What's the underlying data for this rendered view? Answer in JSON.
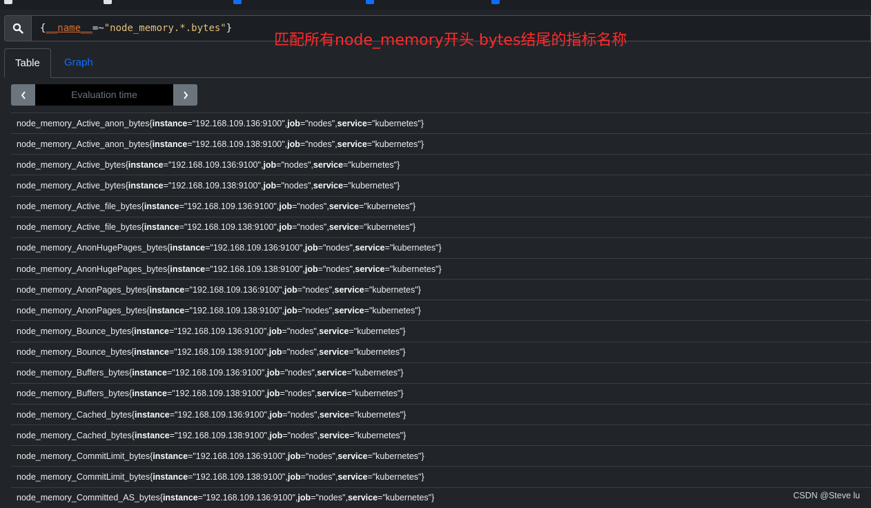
{
  "query": {
    "open_brace": "{",
    "label": "__name__",
    "operator": "=~",
    "value": "\"node_memory.*.bytes\"",
    "close_brace": "}"
  },
  "annotation": "匹配所有node_memory开头   bytes结尾的指标名称",
  "tabs": {
    "table": "Table",
    "graph": "Graph"
  },
  "evaluation": {
    "placeholder": "Evaluation time"
  },
  "label_keys": {
    "instance": "instance",
    "job": "job",
    "service": "service"
  },
  "results": [
    {
      "metric": "node_memory_Active_anon_bytes",
      "instance": "\"192.168.109.136:9100\"",
      "job": "\"nodes\"",
      "service": "\"kubernetes\""
    },
    {
      "metric": "node_memory_Active_anon_bytes",
      "instance": "\"192.168.109.138:9100\"",
      "job": "\"nodes\"",
      "service": "\"kubernetes\""
    },
    {
      "metric": "node_memory_Active_bytes",
      "instance": "\"192.168.109.136:9100\"",
      "job": "\"nodes\"",
      "service": "\"kubernetes\""
    },
    {
      "metric": "node_memory_Active_bytes",
      "instance": "\"192.168.109.138:9100\"",
      "job": "\"nodes\"",
      "service": "\"kubernetes\""
    },
    {
      "metric": "node_memory_Active_file_bytes",
      "instance": "\"192.168.109.136:9100\"",
      "job": "\"nodes\"",
      "service": "\"kubernetes\""
    },
    {
      "metric": "node_memory_Active_file_bytes",
      "instance": "\"192.168.109.138:9100\"",
      "job": "\"nodes\"",
      "service": "\"kubernetes\""
    },
    {
      "metric": "node_memory_AnonHugePages_bytes",
      "instance": "\"192.168.109.136:9100\"",
      "job": "\"nodes\"",
      "service": "\"kubernetes\""
    },
    {
      "metric": "node_memory_AnonHugePages_bytes",
      "instance": "\"192.168.109.138:9100\"",
      "job": "\"nodes\"",
      "service": "\"kubernetes\""
    },
    {
      "metric": "node_memory_AnonPages_bytes",
      "instance": "\"192.168.109.136:9100\"",
      "job": "\"nodes\"",
      "service": "\"kubernetes\""
    },
    {
      "metric": "node_memory_AnonPages_bytes",
      "instance": "\"192.168.109.138:9100\"",
      "job": "\"nodes\"",
      "service": "\"kubernetes\""
    },
    {
      "metric": "node_memory_Bounce_bytes",
      "instance": "\"192.168.109.136:9100\"",
      "job": "\"nodes\"",
      "service": "\"kubernetes\""
    },
    {
      "metric": "node_memory_Bounce_bytes",
      "instance": "\"192.168.109.138:9100\"",
      "job": "\"nodes\"",
      "service": "\"kubernetes\""
    },
    {
      "metric": "node_memory_Buffers_bytes",
      "instance": "\"192.168.109.136:9100\"",
      "job": "\"nodes\"",
      "service": "\"kubernetes\""
    },
    {
      "metric": "node_memory_Buffers_bytes",
      "instance": "\"192.168.109.138:9100\"",
      "job": "\"nodes\"",
      "service": "\"kubernetes\""
    },
    {
      "metric": "node_memory_Cached_bytes",
      "instance": "\"192.168.109.136:9100\"",
      "job": "\"nodes\"",
      "service": "\"kubernetes\""
    },
    {
      "metric": "node_memory_Cached_bytes",
      "instance": "\"192.168.109.138:9100\"",
      "job": "\"nodes\"",
      "service": "\"kubernetes\""
    },
    {
      "metric": "node_memory_CommitLimit_bytes",
      "instance": "\"192.168.109.136:9100\"",
      "job": "\"nodes\"",
      "service": "\"kubernetes\""
    },
    {
      "metric": "node_memory_CommitLimit_bytes",
      "instance": "\"192.168.109.138:9100\"",
      "job": "\"nodes\"",
      "service": "\"kubernetes\""
    },
    {
      "metric": "node_memory_Committed_AS_bytes",
      "instance": "\"192.168.109.136:9100\"",
      "job": "\"nodes\"",
      "service": "\"kubernetes\""
    }
  ],
  "watermark": "CSDN @Steve lu",
  "colors": {
    "background": "#212529",
    "link": "#0d6efd",
    "annotation": "#ff2a2a",
    "label_name": "#e06c2b",
    "string": "#e5c07b"
  },
  "icons": {
    "search": "search-icon",
    "prev": "chevron-left-icon",
    "next": "chevron-right-icon"
  }
}
